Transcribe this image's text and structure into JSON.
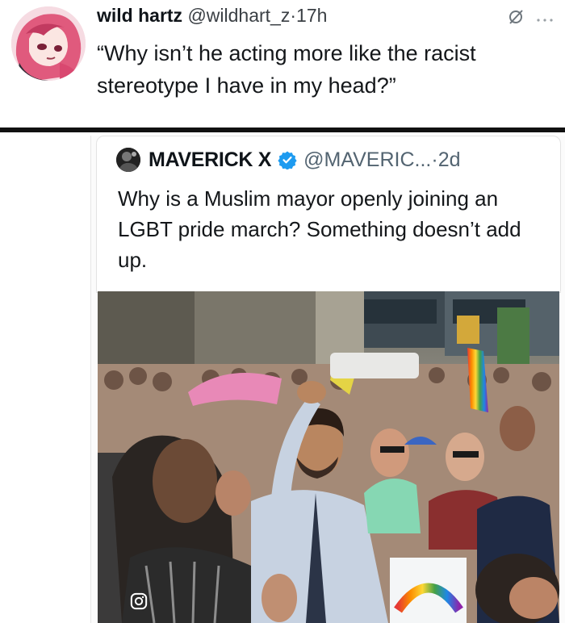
{
  "top_tweet": {
    "display_name": "wild hartz",
    "handle": "@wildhart_z",
    "separator": "·",
    "time": "17h",
    "text": "“Why isn’t he acting more like the racist stereotype I have in my head?”",
    "icons": [
      "muted-slash-icon",
      "more-icon"
    ]
  },
  "quoted_tweet": {
    "display_name": "MAVERICK X",
    "handle": "@MAVERIC...",
    "separator": "·",
    "time": "2d",
    "verified": true,
    "text": "Why is a Muslim mayor openly joining an LGBT pride march? Something doesn’t add up.",
    "photo_watermark_icon": "instagram-icon"
  },
  "colors": {
    "verified": "#1d9bf0",
    "divider": "#111111",
    "muted_text": "#536471"
  }
}
